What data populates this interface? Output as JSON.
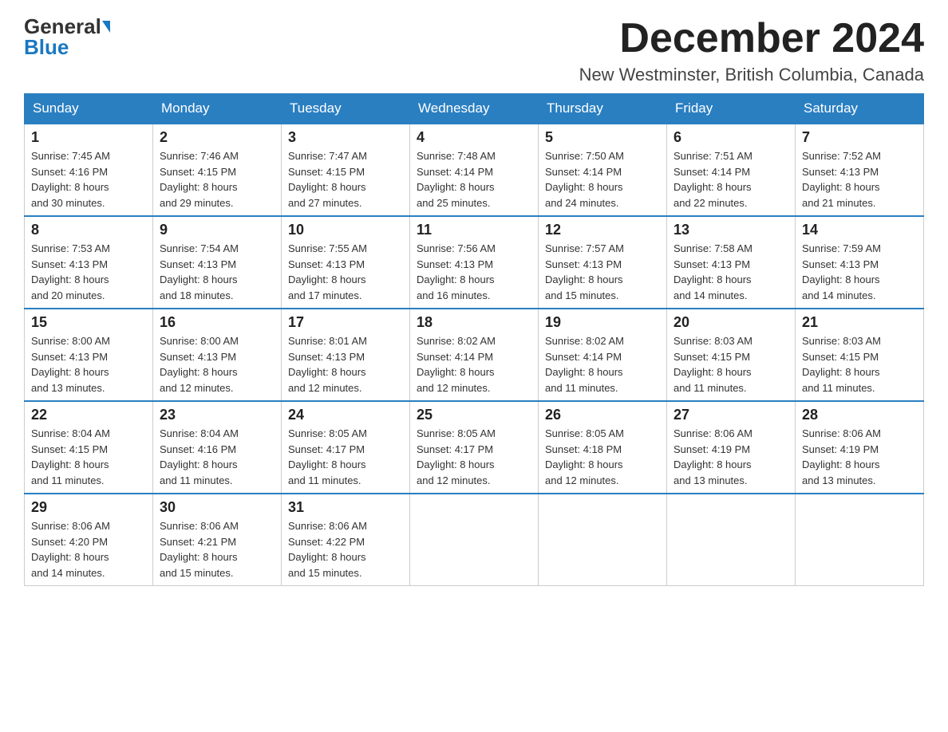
{
  "header": {
    "logo_general": "General",
    "logo_blue": "Blue",
    "title": "December 2024",
    "subtitle": "New Westminster, British Columbia, Canada"
  },
  "columns": [
    "Sunday",
    "Monday",
    "Tuesday",
    "Wednesday",
    "Thursday",
    "Friday",
    "Saturday"
  ],
  "weeks": [
    [
      {
        "day": "1",
        "sunrise": "7:45 AM",
        "sunset": "4:16 PM",
        "daylight": "8 hours and 30 minutes."
      },
      {
        "day": "2",
        "sunrise": "7:46 AM",
        "sunset": "4:15 PM",
        "daylight": "8 hours and 29 minutes."
      },
      {
        "day": "3",
        "sunrise": "7:47 AM",
        "sunset": "4:15 PM",
        "daylight": "8 hours and 27 minutes."
      },
      {
        "day": "4",
        "sunrise": "7:48 AM",
        "sunset": "4:14 PM",
        "daylight": "8 hours and 25 minutes."
      },
      {
        "day": "5",
        "sunrise": "7:50 AM",
        "sunset": "4:14 PM",
        "daylight": "8 hours and 24 minutes."
      },
      {
        "day": "6",
        "sunrise": "7:51 AM",
        "sunset": "4:14 PM",
        "daylight": "8 hours and 22 minutes."
      },
      {
        "day": "7",
        "sunrise": "7:52 AM",
        "sunset": "4:13 PM",
        "daylight": "8 hours and 21 minutes."
      }
    ],
    [
      {
        "day": "8",
        "sunrise": "7:53 AM",
        "sunset": "4:13 PM",
        "daylight": "8 hours and 20 minutes."
      },
      {
        "day": "9",
        "sunrise": "7:54 AM",
        "sunset": "4:13 PM",
        "daylight": "8 hours and 18 minutes."
      },
      {
        "day": "10",
        "sunrise": "7:55 AM",
        "sunset": "4:13 PM",
        "daylight": "8 hours and 17 minutes."
      },
      {
        "day": "11",
        "sunrise": "7:56 AM",
        "sunset": "4:13 PM",
        "daylight": "8 hours and 16 minutes."
      },
      {
        "day": "12",
        "sunrise": "7:57 AM",
        "sunset": "4:13 PM",
        "daylight": "8 hours and 15 minutes."
      },
      {
        "day": "13",
        "sunrise": "7:58 AM",
        "sunset": "4:13 PM",
        "daylight": "8 hours and 14 minutes."
      },
      {
        "day": "14",
        "sunrise": "7:59 AM",
        "sunset": "4:13 PM",
        "daylight": "8 hours and 14 minutes."
      }
    ],
    [
      {
        "day": "15",
        "sunrise": "8:00 AM",
        "sunset": "4:13 PM",
        "daylight": "8 hours and 13 minutes."
      },
      {
        "day": "16",
        "sunrise": "8:00 AM",
        "sunset": "4:13 PM",
        "daylight": "8 hours and 12 minutes."
      },
      {
        "day": "17",
        "sunrise": "8:01 AM",
        "sunset": "4:13 PM",
        "daylight": "8 hours and 12 minutes."
      },
      {
        "day": "18",
        "sunrise": "8:02 AM",
        "sunset": "4:14 PM",
        "daylight": "8 hours and 12 minutes."
      },
      {
        "day": "19",
        "sunrise": "8:02 AM",
        "sunset": "4:14 PM",
        "daylight": "8 hours and 11 minutes."
      },
      {
        "day": "20",
        "sunrise": "8:03 AM",
        "sunset": "4:15 PM",
        "daylight": "8 hours and 11 minutes."
      },
      {
        "day": "21",
        "sunrise": "8:03 AM",
        "sunset": "4:15 PM",
        "daylight": "8 hours and 11 minutes."
      }
    ],
    [
      {
        "day": "22",
        "sunrise": "8:04 AM",
        "sunset": "4:15 PM",
        "daylight": "8 hours and 11 minutes."
      },
      {
        "day": "23",
        "sunrise": "8:04 AM",
        "sunset": "4:16 PM",
        "daylight": "8 hours and 11 minutes."
      },
      {
        "day": "24",
        "sunrise": "8:05 AM",
        "sunset": "4:17 PM",
        "daylight": "8 hours and 11 minutes."
      },
      {
        "day": "25",
        "sunrise": "8:05 AM",
        "sunset": "4:17 PM",
        "daylight": "8 hours and 12 minutes."
      },
      {
        "day": "26",
        "sunrise": "8:05 AM",
        "sunset": "4:18 PM",
        "daylight": "8 hours and 12 minutes."
      },
      {
        "day": "27",
        "sunrise": "8:06 AM",
        "sunset": "4:19 PM",
        "daylight": "8 hours and 13 minutes."
      },
      {
        "day": "28",
        "sunrise": "8:06 AM",
        "sunset": "4:19 PM",
        "daylight": "8 hours and 13 minutes."
      }
    ],
    [
      {
        "day": "29",
        "sunrise": "8:06 AM",
        "sunset": "4:20 PM",
        "daylight": "8 hours and 14 minutes."
      },
      {
        "day": "30",
        "sunrise": "8:06 AM",
        "sunset": "4:21 PM",
        "daylight": "8 hours and 15 minutes."
      },
      {
        "day": "31",
        "sunrise": "8:06 AM",
        "sunset": "4:22 PM",
        "daylight": "8 hours and 15 minutes."
      },
      null,
      null,
      null,
      null
    ]
  ],
  "labels": {
    "sunrise": "Sunrise:",
    "sunset": "Sunset:",
    "daylight": "Daylight:"
  }
}
